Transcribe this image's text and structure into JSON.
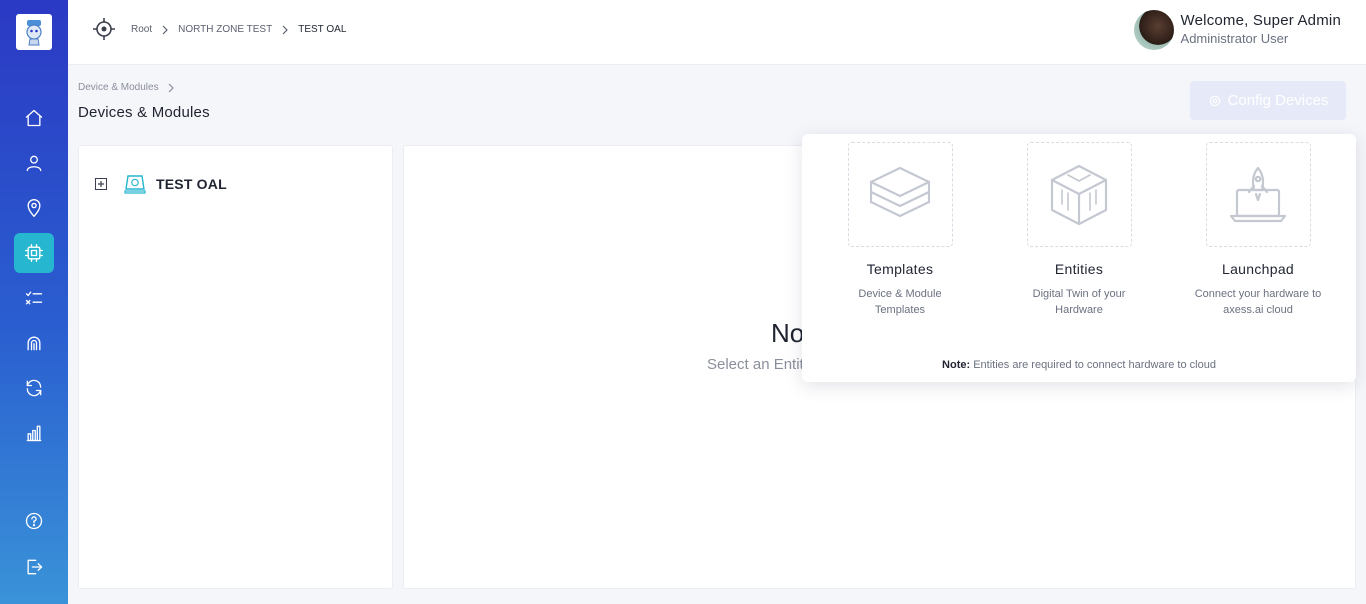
{
  "header": {
    "breadcrumb": [
      "Root",
      "NORTH ZONE TEST",
      "TEST OAL"
    ],
    "welcome": "Welcome, Super Admin",
    "role": "Administrator User"
  },
  "sidebar": {
    "items": [
      {
        "icon": "home-icon"
      },
      {
        "icon": "user-icon"
      },
      {
        "icon": "location-pin-icon"
      },
      {
        "icon": "chip-icon",
        "active": true
      },
      {
        "icon": "checklist-icon"
      },
      {
        "icon": "fingerprint-icon"
      },
      {
        "icon": "refresh-icon"
      },
      {
        "icon": "bar-chart-icon"
      },
      {
        "icon": "help-icon"
      },
      {
        "icon": "logout-icon"
      }
    ]
  },
  "page": {
    "breadcrumb": "Device & Modules",
    "title": "Devices & Modules",
    "config_button": "Config Devices"
  },
  "tree": {
    "node_label": "TEST OAL"
  },
  "main": {
    "empty_title": "No",
    "empty_subtitle": "Select an Entit"
  },
  "popover": {
    "cards": [
      {
        "title": "Templates",
        "desc_line1": "Device & Module",
        "desc_line2": "Templates",
        "icon": "layers-icon"
      },
      {
        "title": "Entities",
        "desc_line1": "Digital Twin of your",
        "desc_line2": "Hardware",
        "icon": "cube-circuit-icon"
      },
      {
        "title": "Launchpad",
        "desc_line1": "Connect your hardware to",
        "desc_line2": "axess.ai cloud",
        "icon": "rocket-laptop-icon"
      }
    ],
    "note_label": "Note:",
    "note_text": "Entities are required to connect hardware to cloud"
  },
  "colors": {
    "sidebar_top": "#2b39c4",
    "sidebar_bottom": "#3a93d8",
    "active_nav": "#27b6cf",
    "config_button_disabled": "#e6e9f7"
  }
}
